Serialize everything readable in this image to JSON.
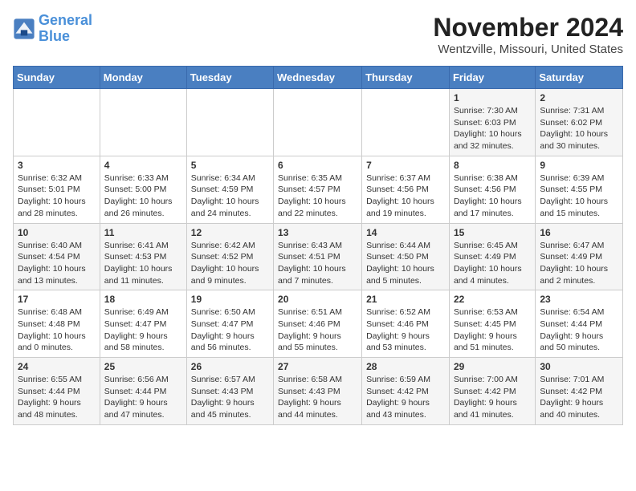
{
  "logo": {
    "line1": "General",
    "line2": "Blue"
  },
  "title": "November 2024",
  "location": "Wentzville, Missouri, United States",
  "days_of_week": [
    "Sunday",
    "Monday",
    "Tuesday",
    "Wednesday",
    "Thursday",
    "Friday",
    "Saturday"
  ],
  "weeks": [
    [
      {
        "day": "",
        "info": ""
      },
      {
        "day": "",
        "info": ""
      },
      {
        "day": "",
        "info": ""
      },
      {
        "day": "",
        "info": ""
      },
      {
        "day": "",
        "info": ""
      },
      {
        "day": "1",
        "info": "Sunrise: 7:30 AM\nSunset: 6:03 PM\nDaylight: 10 hours and 32 minutes."
      },
      {
        "day": "2",
        "info": "Sunrise: 7:31 AM\nSunset: 6:02 PM\nDaylight: 10 hours and 30 minutes."
      }
    ],
    [
      {
        "day": "3",
        "info": "Sunrise: 6:32 AM\nSunset: 5:01 PM\nDaylight: 10 hours and 28 minutes."
      },
      {
        "day": "4",
        "info": "Sunrise: 6:33 AM\nSunset: 5:00 PM\nDaylight: 10 hours and 26 minutes."
      },
      {
        "day": "5",
        "info": "Sunrise: 6:34 AM\nSunset: 4:59 PM\nDaylight: 10 hours and 24 minutes."
      },
      {
        "day": "6",
        "info": "Sunrise: 6:35 AM\nSunset: 4:57 PM\nDaylight: 10 hours and 22 minutes."
      },
      {
        "day": "7",
        "info": "Sunrise: 6:37 AM\nSunset: 4:56 PM\nDaylight: 10 hours and 19 minutes."
      },
      {
        "day": "8",
        "info": "Sunrise: 6:38 AM\nSunset: 4:56 PM\nDaylight: 10 hours and 17 minutes."
      },
      {
        "day": "9",
        "info": "Sunrise: 6:39 AM\nSunset: 4:55 PM\nDaylight: 10 hours and 15 minutes."
      }
    ],
    [
      {
        "day": "10",
        "info": "Sunrise: 6:40 AM\nSunset: 4:54 PM\nDaylight: 10 hours and 13 minutes."
      },
      {
        "day": "11",
        "info": "Sunrise: 6:41 AM\nSunset: 4:53 PM\nDaylight: 10 hours and 11 minutes."
      },
      {
        "day": "12",
        "info": "Sunrise: 6:42 AM\nSunset: 4:52 PM\nDaylight: 10 hours and 9 minutes."
      },
      {
        "day": "13",
        "info": "Sunrise: 6:43 AM\nSunset: 4:51 PM\nDaylight: 10 hours and 7 minutes."
      },
      {
        "day": "14",
        "info": "Sunrise: 6:44 AM\nSunset: 4:50 PM\nDaylight: 10 hours and 5 minutes."
      },
      {
        "day": "15",
        "info": "Sunrise: 6:45 AM\nSunset: 4:49 PM\nDaylight: 10 hours and 4 minutes."
      },
      {
        "day": "16",
        "info": "Sunrise: 6:47 AM\nSunset: 4:49 PM\nDaylight: 10 hours and 2 minutes."
      }
    ],
    [
      {
        "day": "17",
        "info": "Sunrise: 6:48 AM\nSunset: 4:48 PM\nDaylight: 10 hours and 0 minutes."
      },
      {
        "day": "18",
        "info": "Sunrise: 6:49 AM\nSunset: 4:47 PM\nDaylight: 9 hours and 58 minutes."
      },
      {
        "day": "19",
        "info": "Sunrise: 6:50 AM\nSunset: 4:47 PM\nDaylight: 9 hours and 56 minutes."
      },
      {
        "day": "20",
        "info": "Sunrise: 6:51 AM\nSunset: 4:46 PM\nDaylight: 9 hours and 55 minutes."
      },
      {
        "day": "21",
        "info": "Sunrise: 6:52 AM\nSunset: 4:46 PM\nDaylight: 9 hours and 53 minutes."
      },
      {
        "day": "22",
        "info": "Sunrise: 6:53 AM\nSunset: 4:45 PM\nDaylight: 9 hours and 51 minutes."
      },
      {
        "day": "23",
        "info": "Sunrise: 6:54 AM\nSunset: 4:44 PM\nDaylight: 9 hours and 50 minutes."
      }
    ],
    [
      {
        "day": "24",
        "info": "Sunrise: 6:55 AM\nSunset: 4:44 PM\nDaylight: 9 hours and 48 minutes."
      },
      {
        "day": "25",
        "info": "Sunrise: 6:56 AM\nSunset: 4:44 PM\nDaylight: 9 hours and 47 minutes."
      },
      {
        "day": "26",
        "info": "Sunrise: 6:57 AM\nSunset: 4:43 PM\nDaylight: 9 hours and 45 minutes."
      },
      {
        "day": "27",
        "info": "Sunrise: 6:58 AM\nSunset: 4:43 PM\nDaylight: 9 hours and 44 minutes."
      },
      {
        "day": "28",
        "info": "Sunrise: 6:59 AM\nSunset: 4:42 PM\nDaylight: 9 hours and 43 minutes."
      },
      {
        "day": "29",
        "info": "Sunrise: 7:00 AM\nSunset: 4:42 PM\nDaylight: 9 hours and 41 minutes."
      },
      {
        "day": "30",
        "info": "Sunrise: 7:01 AM\nSunset: 4:42 PM\nDaylight: 9 hours and 40 minutes."
      }
    ]
  ]
}
